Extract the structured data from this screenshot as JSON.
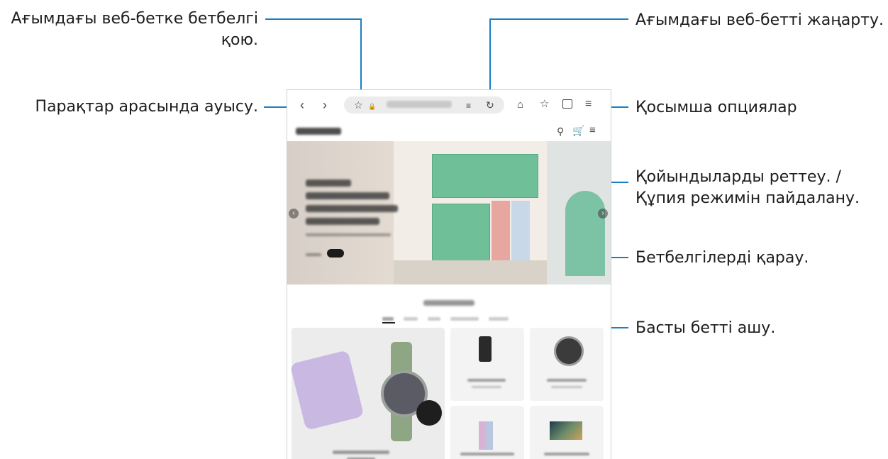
{
  "callouts": {
    "bookmark": {
      "line1": "Ағымдағы веб-бетке бетбелгі",
      "line2": "қою."
    },
    "refresh": "Ағымдағы веб-бетті жаңарту.",
    "navigate": "Парақтар арасында ауысу.",
    "more_options": "Қосымша опциялар",
    "tabs": {
      "line1": "Қойындыларды реттеу. /",
      "line2": "Құпия режимін пайдалану."
    },
    "bookmarks_view": "Бетбелгілерді қарау.",
    "home": "Басты бетті ашу."
  },
  "icons": {
    "back": "chevron-left-icon",
    "forward": "chevron-right-icon",
    "bookmark_add": "star-outline-icon",
    "lock": "lock-icon",
    "reader": "reader-mode-icon",
    "refresh": "refresh-icon",
    "home": "home-icon",
    "bookmarks": "star-icon",
    "tabs": "tabs-icon",
    "menu": "menu-icon",
    "search": "search-icon",
    "cart": "cart-icon",
    "site_menu": "hamburger-icon"
  },
  "colors": {
    "accent": "#1a7fc4"
  }
}
